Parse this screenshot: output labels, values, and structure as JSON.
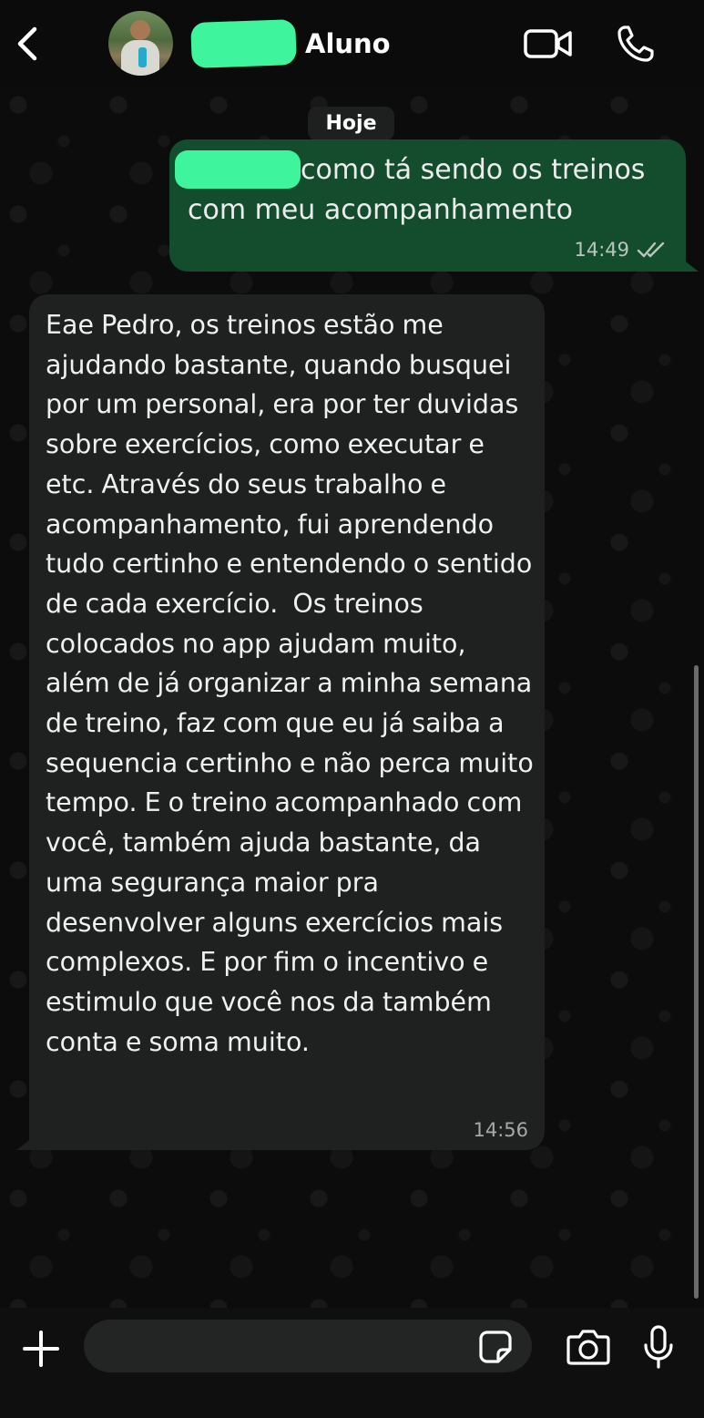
{
  "header": {
    "contact_name": "Aluno",
    "back_icon": "chevron-left-icon",
    "video_icon": "video-camera-icon",
    "call_icon": "phone-icon"
  },
  "chat": {
    "date_label": "Hoje",
    "messages": [
      {
        "direction": "outgoing",
        "text": "como tá sendo os treinos com meu acompanhamento",
        "time": "14:49",
        "status": "read"
      },
      {
        "direction": "incoming",
        "text": "Eae Pedro, os treinos estão me ajudando bastante, quando busquei por um personal, era por ter duvidas sobre exercícios, como executar e etc. Através do seus trabalho e acompanhamento, fui aprendendo tudo certinho e entendendo o sentido de cada exercício.  Os treinos colocados no app ajudam muito, além de já organizar a minha semana de treino, faz com que eu já saiba a sequencia certinho e não perca muito tempo. E o treino acompanhado com você, também ajuda bastante, da uma segurança maior pra desenvolver alguns exercícios mais complexos. E por fim o incentivo e estimulo que você nos da também conta e soma muito.",
        "time": "14:56"
      }
    ]
  },
  "composer": {
    "input_value": "",
    "plus_icon": "plus-icon",
    "sticker_icon": "sticker-icon",
    "camera_icon": "camera-icon",
    "mic_icon": "microphone-icon"
  },
  "colors": {
    "outgoing_bubble": "#134d2e",
    "incoming_bubble": "#1f2020",
    "redaction_marker": "#3ef59e",
    "background": "#0b0b0b"
  }
}
